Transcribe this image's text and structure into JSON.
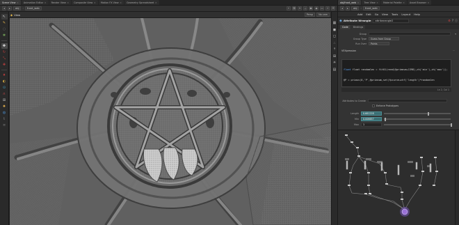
{
  "left_tabs": [
    {
      "label": "Scene View",
      "active": true
    },
    {
      "label": "Animation Editor",
      "active": false
    },
    {
      "label": "Render View",
      "active": false
    },
    {
      "label": "Composite View",
      "active": false
    },
    {
      "label": "Motion FX View",
      "active": false
    },
    {
      "label": "Geometry Spreadsheet",
      "active": false
    }
  ],
  "left_path": {
    "obj": "obj",
    "node": "front_web"
  },
  "viewport_header": {
    "view_label": "View",
    "persp": "Persp",
    "cam": "No cam"
  },
  "right_tabs": [
    {
      "label": "obj/front_web",
      "active": true
    },
    {
      "label": "Tree View",
      "active": false
    },
    {
      "label": "Material Palette",
      "active": false
    },
    {
      "label": "Asset Browser",
      "active": false
    }
  ],
  "right_path": {
    "obj": "obj",
    "node": "front_web"
  },
  "menus": [
    "Add",
    "Edit",
    "Go",
    "View",
    "Tools",
    "Layout",
    "Help"
  ],
  "node": {
    "type": "Attribute Wrangle",
    "name": "attribwrangle2"
  },
  "param_tabs": [
    {
      "label": "Code",
      "active": true
    },
    {
      "label": "Bindings",
      "active": false
    }
  ],
  "params": {
    "group_label": "Group",
    "group_value": "",
    "group_type_label": "Group Type",
    "group_type_value": "Guess from Group",
    "run_over_label": "Run Over",
    "run_over_value": "Points",
    "vex_label": "VEXpression"
  },
  "code_lines": [
    "float randomlen = fit01(rand(@primnum+1398),ch('min'),ch('max'));",
    "@P = primuv(0,'P',@primnum,set(fpcurve+chf('length')*randomlen"
  ],
  "code_status": "Ln 2, Col 1",
  "attributes_to_create_label": "Attributes to Create",
  "enforce_label": "Enforce Prototypes",
  "spare": [
    {
      "label": "Length",
      "value": "0.661228",
      "pos": 0.66
    },
    {
      "label": "Min",
      "value": "0.006657",
      "pos": 0.01
    },
    {
      "label": "Max",
      "value": "1",
      "pos": 1.0
    }
  ],
  "colors": {
    "accent_selected_node": "#9a72d6",
    "field_teal": "#3b6f74"
  }
}
